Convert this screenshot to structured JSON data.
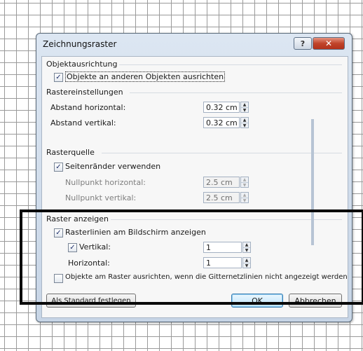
{
  "dialog": {
    "title": "Zeichnungsraster",
    "help_glyph": "?",
    "close_glyph": "✕"
  },
  "objektausrichtung": {
    "heading": "Objektausrichtung",
    "snap_to_objects": {
      "label": "Objekte an anderen Objekten ausrichten",
      "checked": true
    }
  },
  "rastereinstellungen": {
    "heading": "Rastereinstellungen",
    "abstand_horizontal": {
      "label": "Abstand horizontal:",
      "value": "0.32 cm"
    },
    "abstand_vertikal": {
      "label": "Abstand vertikal:",
      "value": "0.32 cm"
    }
  },
  "rasterquelle": {
    "heading": "Rasterquelle",
    "use_margins": {
      "label": "Seitenränder verwenden",
      "checked": true
    },
    "nullpunkt_horizontal": {
      "label": "Nullpunkt horizontal:",
      "value": "2.5 cm"
    },
    "nullpunkt_vertikal": {
      "label": "Nullpunkt vertikal:",
      "value": "2.5 cm"
    }
  },
  "raster_anzeigen": {
    "heading": "Raster anzeigen",
    "show_gridlines": {
      "label": "Rasterlinien am Bildschirm anzeigen",
      "checked": true
    },
    "vertikal": {
      "label": "Vertikal:",
      "checked": true,
      "value": "1"
    },
    "horizontal": {
      "label": "Horizontal:",
      "value": "1"
    },
    "snap_when_hidden": {
      "label": "Objekte am Raster ausrichten, wenn die Gitternetzlinien nicht angezeigt werden",
      "checked": false
    }
  },
  "buttons": {
    "set_default": "Als Standard festlegen",
    "ok": "OK",
    "cancel": "Abbrechen"
  },
  "checkmark": "✓",
  "spin_up": "▲",
  "spin_down": "▼"
}
